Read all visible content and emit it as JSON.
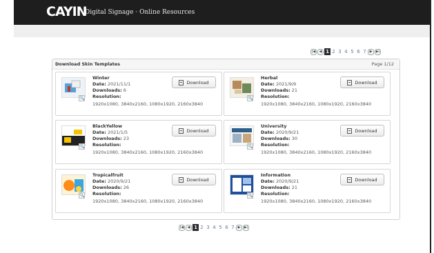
{
  "header": {
    "logo": "CAYIN",
    "tagline": "Digital Signage · Online Resources"
  },
  "pagination": {
    "pages": [
      "1",
      "2",
      "3",
      "4",
      "5",
      "6",
      "7"
    ],
    "current": "1",
    "first_icon": "first-page-icon",
    "prev_icon": "prev-page-icon",
    "next_icon": "next-page-icon",
    "last_icon": "last-page-icon"
  },
  "panel": {
    "title": "Download Skin Templates",
    "page_label": "Page 1/12"
  },
  "labels": {
    "date": "Date:",
    "downloads": "Downloads:",
    "resolution": "Resolution:",
    "download_button": "Download"
  },
  "templates": [
    {
      "name": "Winter",
      "date": "2021/11/1",
      "downloads": "6",
      "resolution": "1920x1080, 3840x2160, 1080x1920, 2160x3840"
    },
    {
      "name": "Herbal",
      "date": "2021/9/9",
      "downloads": "21",
      "resolution": "1920x1080, 3840x2160, 1080x1920, 2160x3840"
    },
    {
      "name": "BlackYellow",
      "date": "2021/1/5",
      "downloads": "23",
      "resolution": "1920x1080, 3840x2160, 1080x1920, 2160x3840"
    },
    {
      "name": "University",
      "date": "2020/9/21",
      "downloads": "30",
      "resolution": "1920x1080, 3840x2160, 1080x1920, 2160x3840"
    },
    {
      "name": "Tropicalfruit",
      "date": "2020/9/21",
      "downloads": "26",
      "resolution": "1920x1080, 3840x2160, 1080x1920, 2160x3840"
    },
    {
      "name": "Information",
      "date": "2020/9/21",
      "downloads": "21",
      "resolution": "1920x1080, 3840x2160, 1080x1920, 2160x3840"
    }
  ]
}
